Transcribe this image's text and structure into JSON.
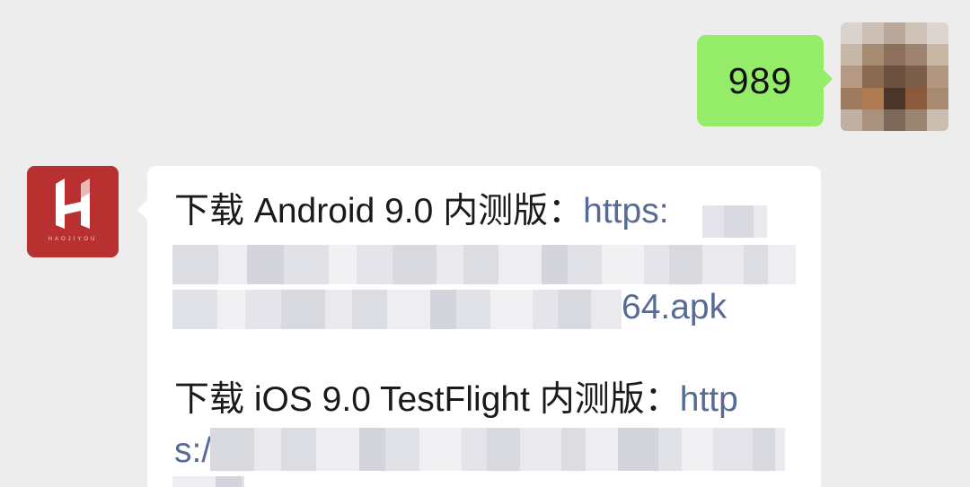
{
  "outgoing": {
    "text": "989",
    "bubble_color": "#95ec69"
  },
  "incoming": {
    "avatar_label": "HAOJIYOU",
    "avatar_color": "#b8302f",
    "line1_prefix": "下载 Android 9.0 内测版：",
    "line1_link": "https:",
    "line3_link_suffix": "64.apk",
    "line4_prefix": "下载 iOS 9.0 TestFlight 内测版：",
    "line4_link": "http",
    "line5_link_start": "s:/",
    "link_color": "#576b95"
  }
}
